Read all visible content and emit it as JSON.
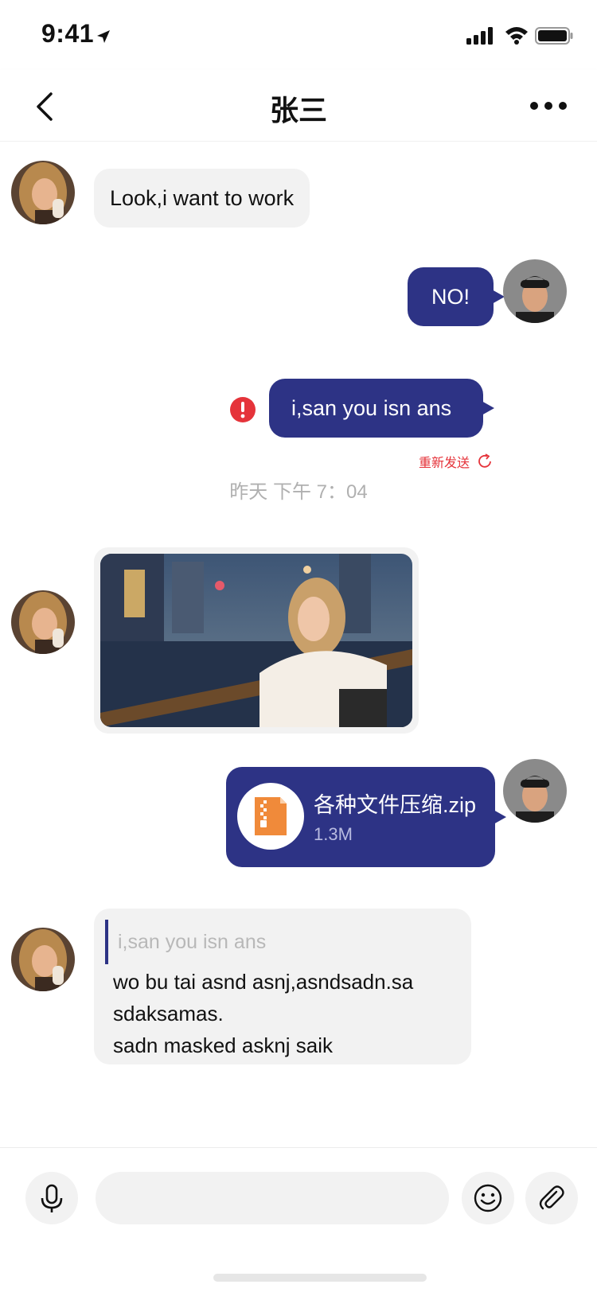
{
  "status_bar": {
    "time": "9:41"
  },
  "nav": {
    "title": "张三"
  },
  "messages": [
    {
      "id": "m1",
      "direction": "incoming",
      "type": "text",
      "text": "Look,i want to work"
    },
    {
      "id": "m2",
      "direction": "outgoing",
      "type": "text",
      "text": "NO!"
    },
    {
      "id": "m3",
      "direction": "outgoing",
      "type": "text",
      "text": "i,san you isn ans",
      "status": "failed",
      "resend_label": "重新发送"
    },
    {
      "id": "m4",
      "direction": "incoming",
      "type": "image"
    },
    {
      "id": "m5",
      "direction": "outgoing",
      "type": "file",
      "file_name": "各种文件压缩.zip",
      "file_size": "1.3M"
    },
    {
      "id": "m6",
      "direction": "incoming",
      "type": "reply",
      "quoted_text": "i,san you isn ans",
      "text_lines": [
        "wo bu tai asnd asnj,asndsadn.sa",
        "sdaksamas.",
        "sadn masked asknj saik"
      ]
    }
  ],
  "timestamp": "昨天 下午 7：04",
  "input": {
    "value": "",
    "placeholder": ""
  },
  "colors": {
    "accent": "#2d3385",
    "bubble_incoming": "#f2f2f2",
    "error": "#e5333a",
    "file_icon": "#f08a3a"
  }
}
